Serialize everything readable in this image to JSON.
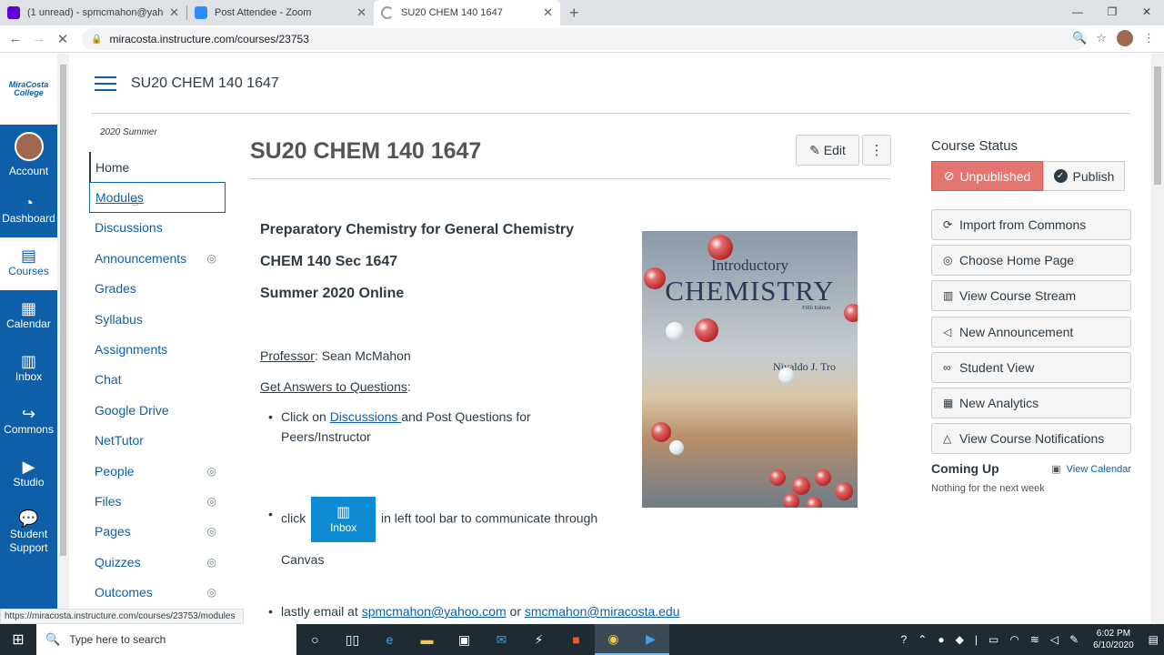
{
  "browser": {
    "tabs": [
      {
        "title": "(1 unread) - spmcmahon@yahoo.c",
        "favicon_color": "#6001d2"
      },
      {
        "title": "Post Attendee - Zoom",
        "favicon_color": "#2d8cff"
      },
      {
        "title": "SU20 CHEM 140 1647",
        "favicon_color": "#9aa0a6"
      }
    ],
    "new_tab": "+",
    "url": "miracosta.instructure.com/courses/23753",
    "status_url": "https://miracosta.instructure.com/courses/23753/modules"
  },
  "global_nav": {
    "logo_text": "MiraCosta College",
    "items": [
      {
        "label": "Account",
        "icon": "avatar-icon"
      },
      {
        "label": "Dashboard",
        "icon": "dashboard-icon"
      },
      {
        "label": "Courses",
        "icon": "book-icon"
      },
      {
        "label": "Calendar",
        "icon": "calendar-icon"
      },
      {
        "label": "Inbox",
        "icon": "inbox-icon"
      },
      {
        "label": "Commons",
        "icon": "commons-icon"
      },
      {
        "label": "Studio",
        "icon": "studio-icon"
      },
      {
        "label": "Student Support",
        "icon": "support-icon"
      }
    ],
    "brand_color": "#0f5fa8"
  },
  "header": {
    "breadcrumb": "SU20 CHEM 140 1647"
  },
  "course_nav": {
    "term": "2020 Summer",
    "items": [
      {
        "label": "Home",
        "hidden": false
      },
      {
        "label": "Modules",
        "hidden": false
      },
      {
        "label": "Discussions",
        "hidden": false
      },
      {
        "label": "Announcements",
        "hidden": true
      },
      {
        "label": "Grades",
        "hidden": false
      },
      {
        "label": "Syllabus",
        "hidden": false
      },
      {
        "label": "Assignments",
        "hidden": false
      },
      {
        "label": "Chat",
        "hidden": false
      },
      {
        "label": "Google Drive",
        "hidden": false
      },
      {
        "label": "NetTutor",
        "hidden": false
      },
      {
        "label": "People",
        "hidden": true
      },
      {
        "label": "Files",
        "hidden": true
      },
      {
        "label": "Pages",
        "hidden": true
      },
      {
        "label": "Quizzes",
        "hidden": true
      },
      {
        "label": "Outcomes",
        "hidden": true
      }
    ]
  },
  "main": {
    "title": "SU20 CHEM 140 1647",
    "edit_label": "Edit",
    "kebab": "⋮",
    "heading1": "Preparatory Chemistry for General Chemistry",
    "heading2": "CHEM 140 Sec 1647",
    "heading3": "Summer 2020 Online",
    "professor_label": "Professor",
    "professor_name": ": Sean McMahon",
    "answers_label": "Get Answers to Questions",
    "answers_colon": ":",
    "bullet1_pre": "Click on ",
    "bullet1_link": "Discussions ",
    "bullet1_post": "and Post Questions for Peers/Instructor",
    "bullet2_pre": "click ",
    "bullet2_btn": "Inbox",
    "bullet2_post": " in left tool bar to communicate through Canvas",
    "bullet3_pre": "lastly email at ",
    "email1": "spmcmahon@yahoo.com",
    "bullet3_mid": " or ",
    "email2": "smcmahon@miracosta.edu",
    "book": {
      "title1": "Introductory",
      "title2": "CHEMISTRY",
      "edition": "Fifth Edition",
      "author": "Nivaldo J. Tro"
    }
  },
  "sidebar": {
    "status_title": "Course Status",
    "unpublished": "Unpublished",
    "publish": "Publish",
    "buttons": [
      {
        "label": "Import from Commons",
        "icon": "commons-icon"
      },
      {
        "label": "Choose Home Page",
        "icon": "home-page-icon"
      },
      {
        "label": "View Course Stream",
        "icon": "stream-icon"
      },
      {
        "label": "New Announcement",
        "icon": "megaphone-icon"
      },
      {
        "label": "Student View",
        "icon": "glasses-icon"
      },
      {
        "label": "New Analytics",
        "icon": "analytics-icon"
      },
      {
        "label": "View Course Notifications",
        "icon": "bell-icon"
      }
    ],
    "coming_up": "Coming Up",
    "view_calendar": "View Calendar",
    "nothing": "Nothing for the next week"
  },
  "taskbar": {
    "search_placeholder": "Type here to search",
    "time": "6:02 PM",
    "date": "6/10/2020"
  }
}
